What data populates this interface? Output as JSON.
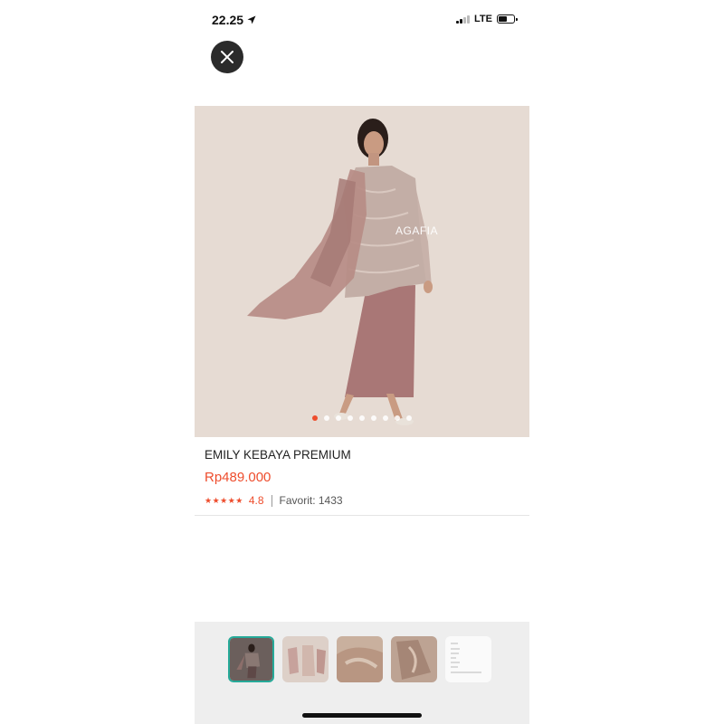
{
  "status_bar": {
    "time": "22.25",
    "network": "LTE"
  },
  "product": {
    "brand_watermark": "AGAFIA",
    "title": "EMILY KEBAYA PREMIUM",
    "price": "Rp489.000",
    "stars": "★★★★★",
    "rating": "4.8",
    "favorite": "Favorit: 1433"
  },
  "gallery": {
    "dot_count": 9,
    "active_index": 0,
    "thumbnail_count": 5,
    "selected_thumbnail": 0
  },
  "colors": {
    "accent": "#ee4d2d",
    "selected_border": "#26aa99",
    "image_background": "#e6dbd3"
  }
}
